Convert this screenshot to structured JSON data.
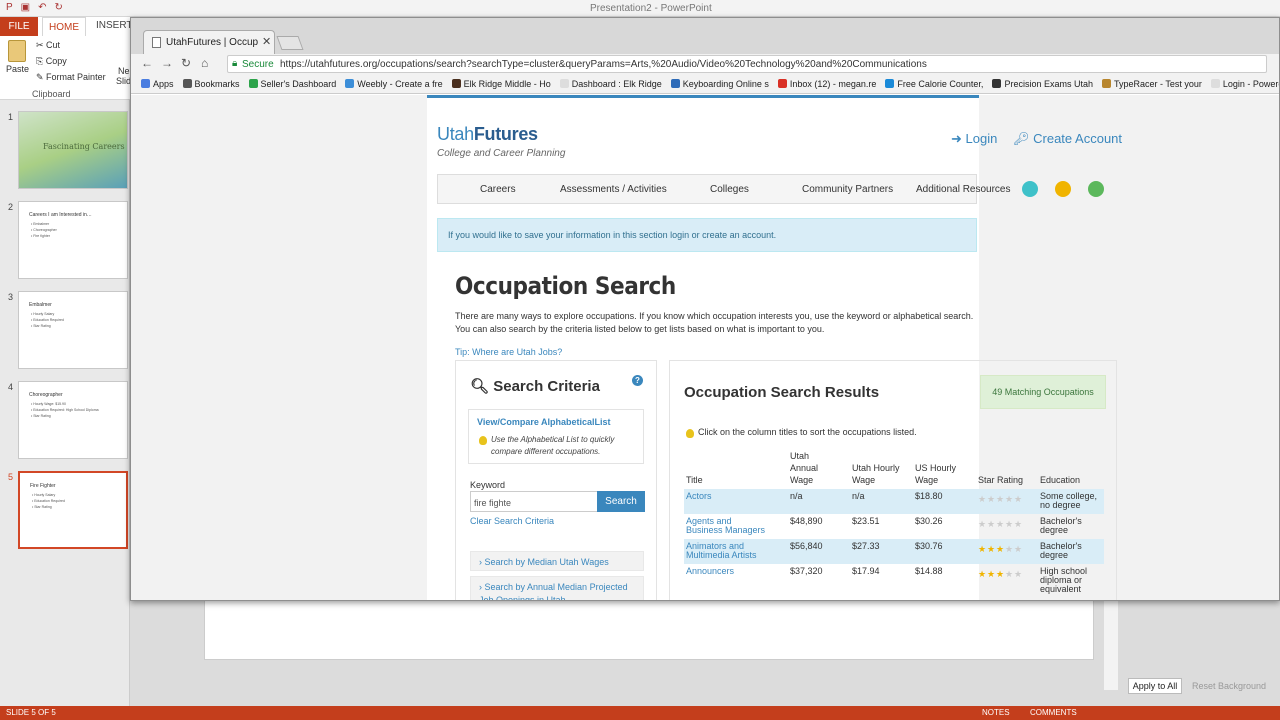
{
  "ppt": {
    "doc_title": "Presentation2 - PowerPoint",
    "tabs": {
      "file": "FILE",
      "home": "HOME",
      "insert": "INSERT"
    },
    "ribbon": {
      "paste": "Paste",
      "cut": "Cut",
      "copy": "Copy",
      "format_painter": "Format Painter",
      "clipboard": "Clipboard",
      "new": "Ne",
      "slide": "Slid"
    },
    "slides": [
      {
        "num": "1",
        "title": "Fascinating Careers",
        "lines": []
      },
      {
        "num": "2",
        "title": "Careers I am Interested in…",
        "lines": [
          "• Embalmer",
          "• Choreographer",
          "• Fire fighter"
        ]
      },
      {
        "num": "3",
        "title": "Embalmer",
        "lines": [
          "• Hourly Salary",
          "• Education Required",
          "• Star Rating"
        ]
      },
      {
        "num": "4",
        "title": "Choreographer",
        "lines": [
          "• Hourly Wage: $15.90",
          "• Education Required: High School Diploma",
          "• Star Rating"
        ]
      },
      {
        "num": "5",
        "title": "Fire Fighter",
        "lines": [
          "• Hourly Salary",
          "• Education Required",
          "• Star Rating"
        ]
      }
    ],
    "apply_all": "Apply to All",
    "reset_bg": "Reset Background",
    "status_left": "SLIDE 5 OF 5",
    "notes": "NOTES",
    "comments": "COMMENTS"
  },
  "browser": {
    "tab_title": "UtahFutures | Occupatio",
    "secure": "Secure",
    "url": "https://utahfutures.org/occupations/search?searchType=cluster&queryParams=Arts,%20Audio/Video%20Technology%20and%20Communications",
    "bookmarks": [
      {
        "label": "Apps",
        "color": "#4a7de0"
      },
      {
        "label": "Bookmarks",
        "color": "#555555"
      },
      {
        "label": "Seller's Dashboard",
        "color": "#2ca34a"
      },
      {
        "label": "Weebly - Create a fre",
        "color": "#3c8ed8"
      },
      {
        "label": "Elk Ridge Middle - Ho",
        "color": "#4a2f1e"
      },
      {
        "label": "Dashboard : Elk Ridge",
        "color": "#dddddd"
      },
      {
        "label": "Keyboarding Online s",
        "color": "#2d6bb8"
      },
      {
        "label": "Inbox (12) - megan.re",
        "color": "#d93025"
      },
      {
        "label": "Free Calorie Counter,",
        "color": "#1a8ad8"
      },
      {
        "label": "Precision Exams Utah",
        "color": "#333333"
      },
      {
        "label": "TypeRacer - Test your",
        "color": "#b8862d"
      },
      {
        "label": "Login - Powered by S",
        "color": "#dddddd"
      }
    ]
  },
  "site": {
    "logo_utah": "Utah",
    "logo_futures": "Futures",
    "tagline": "College and Career Planning",
    "login": "Login",
    "create_account": "Create Account",
    "nav": [
      "Careers",
      "Assessments / Activities",
      "Colleges",
      "Community Partners",
      "Additional Resources"
    ],
    "alert": "If you would like to save your information in this section login or create an account.",
    "heading": "Occupation Search",
    "intro": "There are many ways to explore occupations. If you know which occupation interests you, use the keyword or alphabetical search. You can also search by the criteria listed below to get lists based on what is important to you.",
    "tip": "Tip: Where are Utah Jobs?",
    "criteria": {
      "title": "Search Criteria",
      "alpha_link": "View/Compare AlphabeticalList",
      "alpha_note": "Use the Alphabetical List to quickly compare different occupations.",
      "keyword_label": "Keyword",
      "keyword_value": "fire fighte",
      "search_button": "Search",
      "clear": "Clear Search Criteria",
      "accordions": [
        "› Search by Median Utah Wages",
        "› Search by Annual Median Projected Job Openings in Utah"
      ]
    },
    "results": {
      "title": "Occupation Search Results",
      "count": "49 Matching Occupations",
      "note": "Click on the column titles to sort the occupations listed.",
      "headers": {
        "title": "Title",
        "annual": "Utah Annual Wage",
        "hourly": "Utah Hourly Wage",
        "us": "US Hourly Wage",
        "stars": "Star Rating",
        "edu": "Education"
      },
      "rows": [
        {
          "title": "Actors",
          "annual": "n/a",
          "hourly": "n/a",
          "us": "$18.80",
          "stars": 0,
          "edu": "Some college, no degree"
        },
        {
          "title": "Agents and Business Managers",
          "annual": "$48,890",
          "hourly": "$23.51",
          "us": "$30.26",
          "stars": 0,
          "edu": "Bachelor's degree"
        },
        {
          "title": "Animators and Multimedia Artists",
          "annual": "$56,840",
          "hourly": "$27.33",
          "us": "$30.76",
          "stars": 3,
          "edu": "Bachelor's degree"
        },
        {
          "title": "Announcers",
          "annual": "$37,320",
          "hourly": "$17.94",
          "us": "$14.88",
          "stars": 3,
          "edu": "High school diploma or equivalent"
        }
      ]
    }
  }
}
